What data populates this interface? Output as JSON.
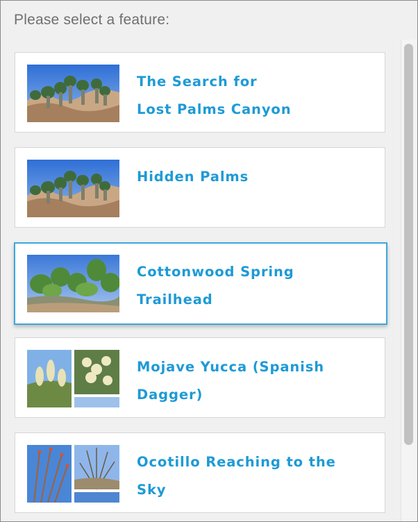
{
  "prompt": "Please select a feature:",
  "features": [
    {
      "title": "The Search for Lost Palms Canyon",
      "line1": "The Search for",
      "line2": "Lost Palms Canyon",
      "thumbnail": "palms-photo",
      "selected": false
    },
    {
      "title": "Hidden Palms",
      "line1": "Hidden Palms",
      "line2": "",
      "thumbnail": "palms-photo",
      "selected": false
    },
    {
      "title": "Cottonwood Spring Trailhead",
      "line1": "Cottonwood Spring",
      "line2": "Trailhead",
      "thumbnail": "cottonwood-photo",
      "selected": true
    },
    {
      "title": "Mojave Yucca (Spanish Dagger)",
      "line1": "Mojave Yucca (Spanish",
      "line2": "Dagger)",
      "thumbnail": "yucca-collage",
      "selected": false
    },
    {
      "title": "Ocotillo Reaching to the Sky",
      "line1": "Ocotillo Reaching to the",
      "line2": "Sky",
      "thumbnail": "ocotillo-collage",
      "selected": false
    }
  ],
  "colors": {
    "accent": "#1e9ad6",
    "selected_border": "#3aa8e0",
    "background": "#f0f0f0"
  }
}
